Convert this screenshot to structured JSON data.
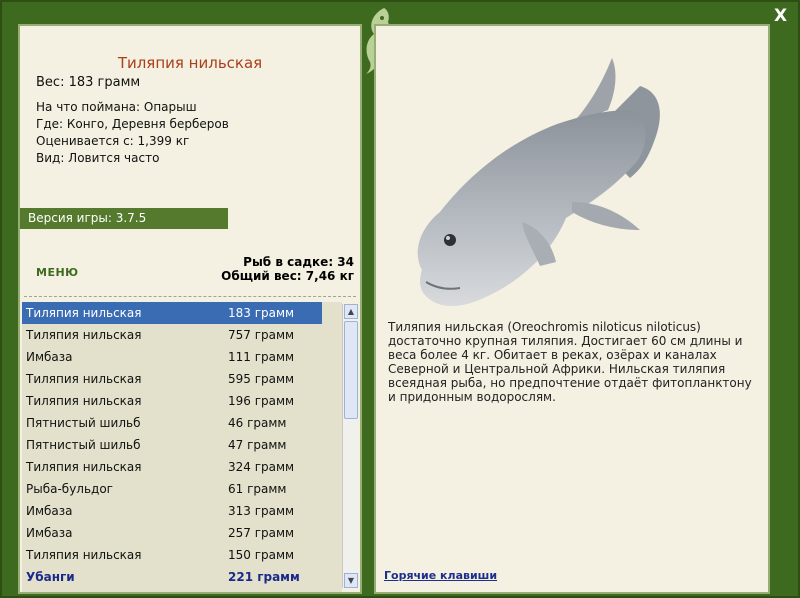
{
  "fish": {
    "title": "Тиляпия нильская",
    "weight": "Вес: 183 грамм",
    "bait": "На что поймана: Опарыш",
    "place": "Где: Конго, Деревня берберов",
    "estimate": "Оценивается с: 1,399 кг",
    "kind": "Вид: Ловится часто",
    "description": "Тиляпия нильская (Oreochromis niloticus niloticus) достаточно крупная тиляпия. Достигает 60 см длины и веса более 4 кг. Обитает в реках, озёрах и каналах Северной и Центральной Африки. Нильская тиляпия всеядная рыба, но предпочтение отдаёт фитопланктону и придонным водорослям."
  },
  "game": {
    "version": "Версия игры: 3.7.5",
    "menu": "МЕНЮ",
    "fish_count": "Рыб в садке: 34",
    "total_weight": "Общий вес: 7,46 кг",
    "hotkeys": "Горячие клавиши",
    "close": "X"
  },
  "catch_list": [
    {
      "name": "Тиляпия нильская",
      "weight": "183 грамм"
    },
    {
      "name": "Тиляпия нильская",
      "weight": "757 грамм"
    },
    {
      "name": "Имбаза",
      "weight": "111 грамм"
    },
    {
      "name": "Тиляпия нильская",
      "weight": "595 грамм"
    },
    {
      "name": "Тиляпия нильская",
      "weight": "196 грамм"
    },
    {
      "name": "Пятнистый шильб",
      "weight": "46 грамм"
    },
    {
      "name": "Пятнистый шильб",
      "weight": "47 грамм"
    },
    {
      "name": "Тиляпия нильская",
      "weight": "324 грамм"
    },
    {
      "name": "Рыба-бульдог",
      "weight": "61 грамм"
    },
    {
      "name": "Имбаза",
      "weight": "313 грамм"
    },
    {
      "name": "Имбаза",
      "weight": "257 грамм"
    },
    {
      "name": "Тиляпия нильская",
      "weight": "150 грамм"
    },
    {
      "name": "Убанги",
      "weight": "221 грамм"
    }
  ],
  "colors": {
    "frame": "#3e6a1f",
    "panel": "#f4f0e2",
    "selection": "#3a6cb4",
    "title": "#a8401c"
  }
}
